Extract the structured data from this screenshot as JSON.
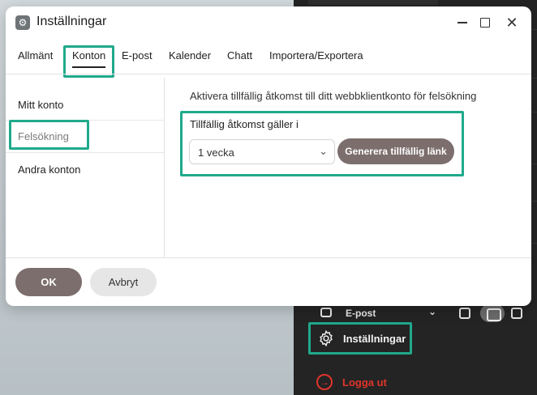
{
  "dialog": {
    "title": "Inställningar",
    "app_icon": "gear-icon",
    "controls": {
      "minimize": "minimize-icon",
      "maximize": "maximize-icon",
      "close": "close-icon",
      "close_glyph": "✕"
    }
  },
  "tabs": [
    {
      "label": "Allmänt",
      "active": false
    },
    {
      "label": "Konton",
      "active": true
    },
    {
      "label": "E-post",
      "active": false
    },
    {
      "label": "Kalender",
      "active": false
    },
    {
      "label": "Chatt",
      "active": false
    },
    {
      "label": "Importera/Exportera",
      "active": false
    }
  ],
  "sidebar": {
    "items": [
      {
        "label": "Mitt konto",
        "selected": false
      },
      {
        "label": "Felsökning",
        "selected": true
      },
      {
        "label": "Andra konton",
        "selected": false
      }
    ]
  },
  "main": {
    "description": "Aktivera tillfällig åtkomst till ditt webbklientkonto för felsökning",
    "access_label": "Tillfällig åtkomst gäller i",
    "duration_value": "1 vecka",
    "generate_button": "Generera tillfällig länk"
  },
  "footer": {
    "ok_label": "OK",
    "cancel_label": "Avbryt"
  },
  "background_menu": {
    "folder_label": "E-post",
    "settings_label": "Inställningar",
    "logout_label": "Logga ut"
  },
  "colors": {
    "highlight": "#1fa98b",
    "primary_button": "#7b6e6c",
    "logout": "#e0352b",
    "panel": "#242424"
  }
}
